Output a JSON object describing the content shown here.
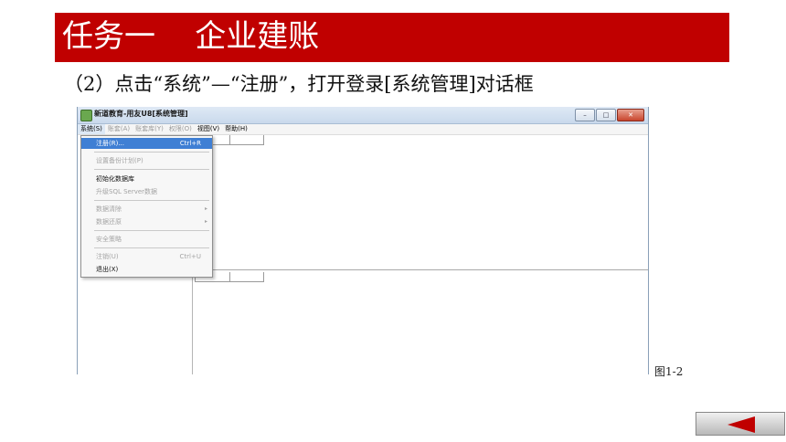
{
  "banner": {
    "title": "任务一    企业建账",
    "color": "#c00000"
  },
  "instruction": "（2）点击“系统”—“注册”，打开登录[系统管理]对话框",
  "window": {
    "title": "新道教育-用友U8[系统管理]",
    "buttons": {
      "minimize": "–",
      "maximize": "□",
      "close": "✕"
    }
  },
  "menubar": [
    {
      "label": "系统(S)",
      "state": "active"
    },
    {
      "label": "账套(A)",
      "state": "disabled"
    },
    {
      "label": "账套库(Y)",
      "state": "disabled"
    },
    {
      "label": "权限(O)",
      "state": "disabled"
    },
    {
      "label": "视图(V)",
      "state": "enabled"
    },
    {
      "label": "帮助(H)",
      "state": "enabled"
    }
  ],
  "dropdown": [
    {
      "label": "注册(R)...",
      "shortcut": "Ctrl+R",
      "state": "selected"
    },
    {
      "label": "设置备份计划(P)",
      "shortcut": "",
      "state": "disabled"
    },
    {
      "label": "初始化数据库",
      "shortcut": "",
      "state": "enabled"
    },
    {
      "label": "升级SQL Server数据",
      "shortcut": "",
      "state": "disabled"
    },
    {
      "label": "数据清除",
      "shortcut": "",
      "state": "disabled",
      "submenu": true
    },
    {
      "label": "数据还原",
      "shortcut": "",
      "state": "disabled",
      "submenu": true
    },
    {
      "label": "安全策略",
      "shortcut": "",
      "state": "disabled"
    },
    {
      "label": "注销(U)",
      "shortcut": "Ctrl+U",
      "state": "disabled"
    },
    {
      "label": "退出(X)",
      "shortcut": "",
      "state": "enabled"
    }
  ],
  "figure_label": "图1-2",
  "nav": {
    "back_icon": "left-triangle-icon"
  }
}
